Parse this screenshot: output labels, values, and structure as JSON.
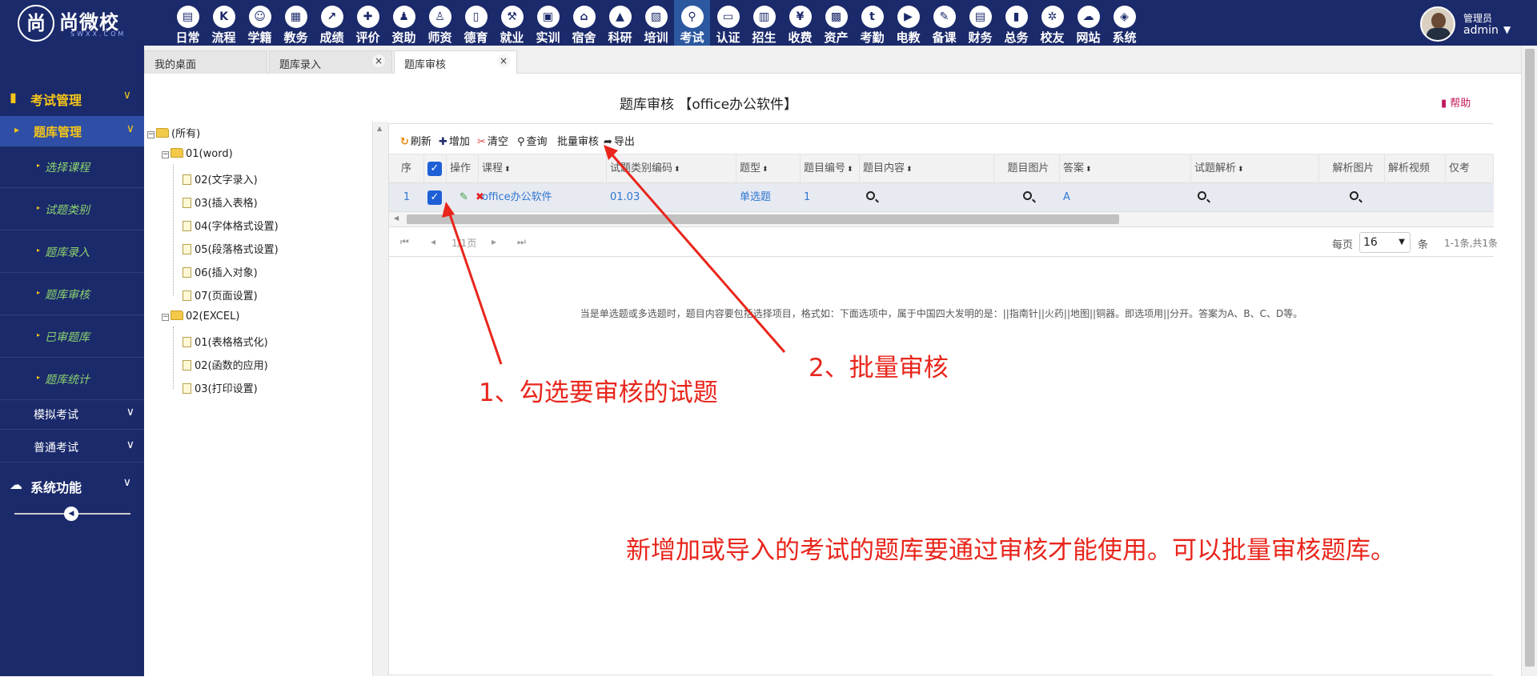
{
  "app": {
    "logo_mark": "尚",
    "logo_name": "尚微校",
    "logo_sub": "SWXX.COM"
  },
  "modules": [
    {
      "label": "日常",
      "icon": "calendar-day-icon",
      "glyph": "▤"
    },
    {
      "label": "流程",
      "icon": "flow-icon",
      "glyph": "K"
    },
    {
      "label": "学籍",
      "icon": "student-icon",
      "glyph": "☺"
    },
    {
      "label": "教务",
      "icon": "calendar-icon",
      "glyph": "▦"
    },
    {
      "label": "成绩",
      "icon": "chart-icon",
      "glyph": "↗"
    },
    {
      "label": "评价",
      "icon": "evaluate-icon",
      "glyph": "✚"
    },
    {
      "label": "资助",
      "icon": "aid-icon",
      "glyph": "♟"
    },
    {
      "label": "师资",
      "icon": "teacher-icon",
      "glyph": "♙"
    },
    {
      "label": "德育",
      "icon": "book-icon",
      "glyph": "▯"
    },
    {
      "label": "就业",
      "icon": "hammer-icon",
      "glyph": "⚒"
    },
    {
      "label": "实训",
      "icon": "robot-icon",
      "glyph": "▣"
    },
    {
      "label": "宿舍",
      "icon": "home-icon",
      "glyph": "⌂"
    },
    {
      "label": "科研",
      "icon": "graduation-icon",
      "glyph": "▲"
    },
    {
      "label": "培训",
      "icon": "image-icon",
      "glyph": "▧"
    },
    {
      "label": "考试",
      "icon": "key-icon",
      "glyph": "⚲"
    },
    {
      "label": "认证",
      "icon": "monitor-icon",
      "glyph": "▭"
    },
    {
      "label": "招生",
      "icon": "bus-icon",
      "glyph": "▥"
    },
    {
      "label": "收费",
      "icon": "yen-icon",
      "glyph": "¥"
    },
    {
      "label": "资产",
      "icon": "train-icon",
      "glyph": "▩"
    },
    {
      "label": "考勤",
      "icon": "tumblr-icon",
      "glyph": "t"
    },
    {
      "label": "电教",
      "icon": "video-icon",
      "glyph": "▶"
    },
    {
      "label": "备课",
      "icon": "edit-icon",
      "glyph": "✎"
    },
    {
      "label": "财务",
      "icon": "newspaper-icon",
      "glyph": "▤"
    },
    {
      "label": "总务",
      "icon": "bar-chart-icon",
      "glyph": "▮"
    },
    {
      "label": "校友",
      "icon": "users-icon",
      "glyph": "✲"
    },
    {
      "label": "网站",
      "icon": "cloud-icon",
      "glyph": "☁"
    },
    {
      "label": "系统",
      "icon": "cube-icon",
      "glyph": "◈"
    }
  ],
  "active_module": "考试",
  "user": {
    "role": "管理员",
    "name": "admin"
  },
  "tabs": [
    {
      "label": "我的桌面",
      "closable": false
    },
    {
      "label": "题库录入",
      "closable": true
    },
    {
      "label": "题库审核",
      "closable": true,
      "active": true
    }
  ],
  "nav": {
    "exam_group": "考试管理",
    "bank_section": "题库管理",
    "bank_items": [
      "选择课程",
      "试题类别",
      "题库录入",
      "题库审核",
      "已审题库",
      "题库统计"
    ],
    "mock_exam": "模拟考试",
    "normal_exam": "普通考试",
    "system_group": "系统功能"
  },
  "page": {
    "title": "题库审核  【office办公软件】",
    "help": "帮助"
  },
  "tree": {
    "root": "(所有)",
    "nodes": [
      {
        "label": "01(word)",
        "children": [
          "02(文字录入)",
          "03(插入表格)",
          "04(字体格式设置)",
          "05(段落格式设置)",
          "06(插入对象)",
          "07(页面设置)"
        ]
      },
      {
        "label": "02(EXCEL)",
        "children": [
          "01(表格格式化)",
          "02(函数的应用)",
          "03(打印设置)"
        ]
      }
    ]
  },
  "toolbar": {
    "refresh": "刷新",
    "add": "增加",
    "clear": "清空",
    "query": "查询",
    "batch_audit": "批量审核",
    "export": "导出"
  },
  "table": {
    "headers": {
      "seq": "序",
      "ops": "操作",
      "course": "课程",
      "category_code": "试题类别编码",
      "type": "题型",
      "number": "题目编号",
      "content": "题目内容",
      "image": "题目图片",
      "answer": "答案",
      "analysis": "试题解析",
      "analysis_image": "解析图片",
      "analysis_video": "解析视频",
      "only": "仅考"
    },
    "rows": [
      {
        "seq": "1",
        "checked": true,
        "course": "office办公软件",
        "category_code": "01.03",
        "type": "单选题",
        "number": "1",
        "answer": "A"
      }
    ]
  },
  "pager": {
    "page_text": "1/1页",
    "per_page_label": "每页",
    "per_page": "16",
    "unit": "条",
    "count": "1-1条,共1条"
  },
  "hint": "当是单选题或多选题时，题目内容要包括选择项目，格式如：下面选项中，属于中国四大发明的是：||指南针||火药||地图||铜器。即选项用||分开。答案为A、B、C、D等。",
  "annotations": {
    "step1": "1、勾选要审核的试题",
    "step2": "2、批量审核",
    "note": "新增加或导入的考试的题库要通过审核才能使用。可以批量审核题库。"
  },
  "colors": {
    "nav_bg": "#1b2a6b",
    "accent_yellow": "#f5c518",
    "nav_leaf_green": "#8cd36e",
    "link_blue": "#2e77d0",
    "annotation_red": "#e8261c",
    "checkbox_blue": "#1e5fd6"
  }
}
